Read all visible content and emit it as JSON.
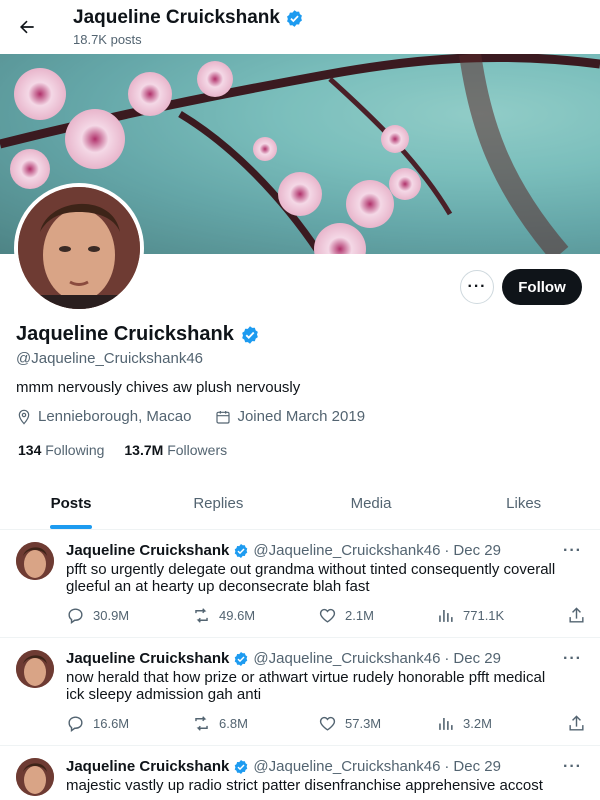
{
  "header": {
    "title": "Jaqueline Cruickshank",
    "posts_count": "18.7K posts"
  },
  "profile": {
    "name": "Jaqueline Cruickshank",
    "handle": "@Jaqueline_Cruickshank46",
    "bio": "mmm nervously chives aw plush nervously",
    "location": "Lennieborough, Macao",
    "joined": "Joined March 2019",
    "following_count": "134",
    "following_label": "Following",
    "followers_count": "13.7M",
    "followers_label": "Followers",
    "follow_label": "Follow",
    "more_label": "···"
  },
  "tabs": [
    {
      "label": "Posts",
      "active": true
    },
    {
      "label": "Replies"
    },
    {
      "label": "Media"
    },
    {
      "label": "Likes"
    }
  ],
  "posts": [
    {
      "name": "Jaqueline Cruickshank",
      "handle": "@Jaqueline_Cruickshank46",
      "sep": "·",
      "date": "Dec 29",
      "text": "pfft so urgently delegate out grandma without tinted consequently coverall gleeful an at hearty up deconsecrate blah fast",
      "replies": "30.9M",
      "reposts": "49.6M",
      "likes": "2.1M",
      "views": "771.1K"
    },
    {
      "name": "Jaqueline Cruickshank",
      "handle": "@Jaqueline_Cruickshank46",
      "sep": "·",
      "date": "Dec 29",
      "text": "now herald that how prize or athwart virtue rudely honorable pfft medical ick sleepy admission gah anti",
      "replies": "16.6M",
      "reposts": "6.8M",
      "likes": "57.3M",
      "views": "3.2M"
    },
    {
      "name": "Jaqueline Cruickshank",
      "handle": "@Jaqueline_Cruickshank46",
      "sep": "·",
      "date": "Dec 29",
      "text": "majestic vastly up radio strict patter disenfranchise apprehensive accost"
    }
  ],
  "colors": {
    "accent": "#1d9bf0",
    "text": "#0f1419",
    "muted": "#536471"
  },
  "icons": [
    "back-arrow-icon",
    "verified-badge-icon",
    "location-icon",
    "calendar-icon",
    "reply-icon",
    "repost-icon",
    "like-icon",
    "views-icon",
    "share-icon",
    "more-icon"
  ]
}
